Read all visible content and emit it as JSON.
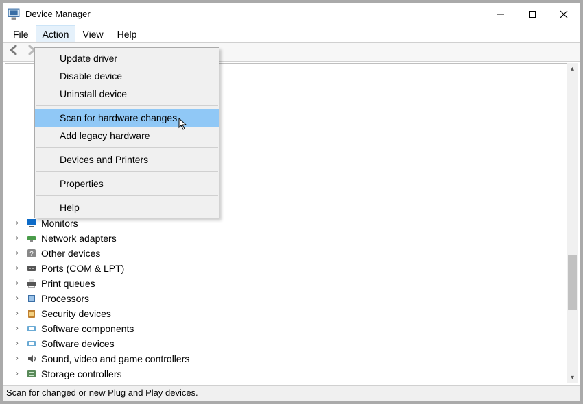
{
  "window": {
    "title": "Device Manager"
  },
  "menubar": {
    "file": "File",
    "action": "Action",
    "view": "View",
    "help": "Help"
  },
  "action_menu": {
    "update_driver": "Update driver",
    "disable_device": "Disable device",
    "uninstall_device": "Uninstall device",
    "scan_hardware": "Scan for hardware changes",
    "add_legacy": "Add legacy hardware",
    "devices_printers": "Devices and Printers",
    "properties": "Properties",
    "help": "Help"
  },
  "tree": {
    "items": [
      {
        "label": "Monitors",
        "icon": "monitor"
      },
      {
        "label": "Network adapters",
        "icon": "network"
      },
      {
        "label": "Other devices",
        "icon": "unknown"
      },
      {
        "label": "Ports (COM & LPT)",
        "icon": "port"
      },
      {
        "label": "Print queues",
        "icon": "printer"
      },
      {
        "label": "Processors",
        "icon": "cpu"
      },
      {
        "label": "Security devices",
        "icon": "security"
      },
      {
        "label": "Software components",
        "icon": "software"
      },
      {
        "label": "Software devices",
        "icon": "software"
      },
      {
        "label": "Sound, video and game controllers",
        "icon": "sound"
      },
      {
        "label": "Storage controllers",
        "icon": "storage"
      }
    ]
  },
  "statusbar": {
    "text": "Scan for changed or new Plug and Play devices."
  }
}
